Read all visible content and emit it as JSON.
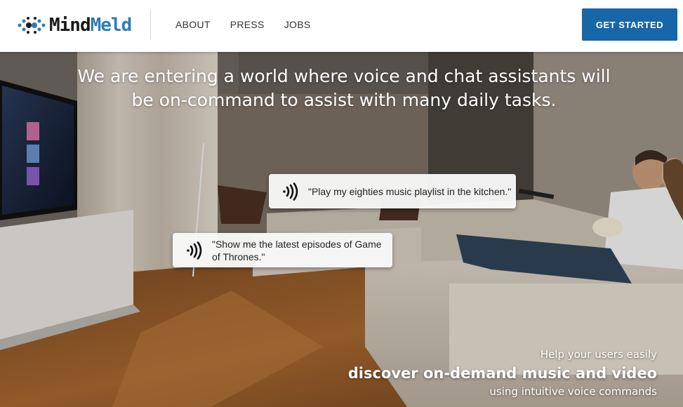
{
  "brand": {
    "name_part1": "Mind",
    "name_part2": "Meld",
    "text_color": "#1a1a1a",
    "accent_color": "#2d7cb8"
  },
  "nav": {
    "items": [
      {
        "label": "ABOUT"
      },
      {
        "label": "PRESS"
      },
      {
        "label": "JOBS"
      }
    ]
  },
  "cta": {
    "label": "GET STARTED",
    "color": "#1766a8"
  },
  "hero": {
    "headline": "We are entering a world where voice and chat assistants will be on-command to assist with many daily tasks.",
    "bubbles": [
      {
        "icon": "sound-wave-icon",
        "quote": "\"Play my eighties music playlist in the kitchen.\""
      },
      {
        "icon": "sound-wave-icon",
        "quote": "\"Show me the latest episodes of Game of Thrones.\""
      }
    ],
    "tagline": {
      "line1": "Help your users easily",
      "line2": "discover on-demand music and video",
      "line3": "using intuitive voice commands"
    }
  }
}
